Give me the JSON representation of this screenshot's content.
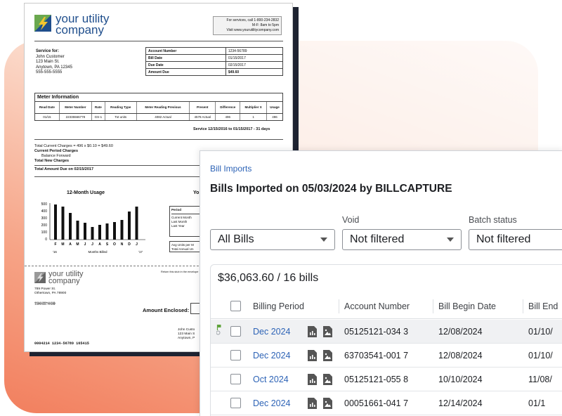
{
  "bill": {
    "logo_line1": "your utility",
    "logo_line2": "company",
    "service_box": [
      "For services, call 1-800-234-2832",
      "M-F: 8am to 5pm",
      "Visit www.yourutilitycompany.com"
    ],
    "service_for_label": "Service for:",
    "customer_lines": [
      "John Customer",
      "123 Main St.",
      "Anytown, PA 12345",
      "555-555-5555"
    ],
    "account_rows": [
      {
        "label": "Account Number",
        "value": "1234-56789"
      },
      {
        "label": "Bill Date",
        "value": "01/15/2017"
      },
      {
        "label": "Due Date",
        "value": "02/15/2017"
      },
      {
        "label": "Amount Due",
        "value": "$49.60"
      }
    ],
    "meter_title": "Meter Information",
    "meter_headers": [
      "Read Date",
      "Meter Number",
      "Rate",
      "Reading Type",
      "Meter Reading Previous",
      "Present",
      "Difference",
      "Multiplier X",
      "Usage"
    ],
    "meter_row": [
      "01/15",
      "22335566778",
      "GS-1",
      "Tot units",
      "4082 Actual",
      "4578 Actual",
      "496",
      "1",
      "496"
    ],
    "service_period": "Service 12/15/2016 to 01/15/2017 - 31 days",
    "totals_lines": [
      "Total Current Charges = 496 x $0.10 = $49.60",
      "Current Period Charges",
      "Balance Forward",
      "Total New Charges"
    ],
    "total_due_line": "Total Amount Due on 02/15/2017",
    "usage_title": "12-Month Usage",
    "you_title": "Yo",
    "usage_yticks": [
      "500",
      "400",
      "300",
      "200",
      "100",
      "0"
    ],
    "usage_months": [
      "F",
      "M",
      "A",
      "M",
      "J",
      "J",
      "A",
      "S",
      "O",
      "N",
      "D",
      "J"
    ],
    "usage_xlabels": [
      "'16",
      "Months Billed",
      "'17"
    ],
    "period_box": [
      "Period",
      "Current Month",
      "Last Month",
      "Last Year"
    ],
    "avg_box": [
      "Avg Units per M",
      "Total Annual Un"
    ],
    "stub_logo_line1": "your utility",
    "stub_logo_line2": "company",
    "stub_address": [
      "789 Power St.",
      "Othertown, PA 78900"
    ],
    "barcode": "'||'|||ı|ı||ı|||'||'|''ı|ı|ı|||ı|||ı",
    "return_note": "Return this stub in the envelope",
    "amount_enclosed": "Amount Enclosed:",
    "stub_customer": [
      "John Custo",
      "123 Main S",
      "Anytown, P"
    ],
    "scanline": "0004214 1234-56789 165415"
  },
  "usage_chart": {
    "type": "bar",
    "categories": [
      "F",
      "M",
      "A",
      "M",
      "J",
      "J",
      "A",
      "S",
      "O",
      "N",
      "D",
      "J"
    ],
    "values": [
      500,
      470,
      380,
      270,
      240,
      180,
      210,
      230,
      250,
      280,
      400,
      470
    ],
    "ylim": [
      0,
      500
    ]
  },
  "app": {
    "breadcrumb": "Bill Imports",
    "title": "Bills Imported on 05/03/2024 by BILLCAPTURE",
    "filters": [
      {
        "label": "",
        "value": "All Bills"
      },
      {
        "label": "Void",
        "value": "Not filtered"
      },
      {
        "label": "Batch status",
        "value": "Not filtered"
      }
    ],
    "summary": "$36,063.60 / 16 bills",
    "columns": [
      "Billing Period",
      "Account Number",
      "Bill Begin Date",
      "Bill End"
    ],
    "rows": [
      {
        "period": "Dec 2024",
        "account": "05125121-034 3",
        "begin": "12/08/2024",
        "end": "01/10/"
      },
      {
        "period": "Dec 2024",
        "account": "63703541-001 7",
        "begin": "12/08/2024",
        "end": "01/10/"
      },
      {
        "period": "Oct 2024",
        "account": "05125121-055 8",
        "begin": "10/10/2024",
        "end": "11/08/"
      },
      {
        "period": "Dec 2024",
        "account": "00051661-041 7",
        "begin": "12/14/2024",
        "end": "01/1"
      }
    ],
    "colors": {
      "accent": "#2d63b6",
      "flag": "#5fa33b"
    }
  }
}
